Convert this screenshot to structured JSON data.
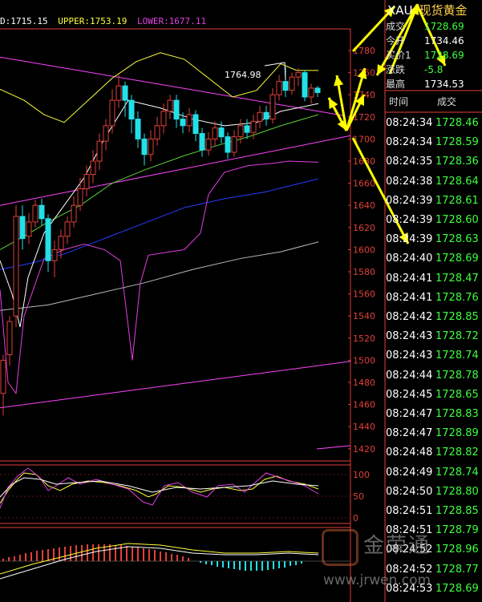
{
  "indicator_bar": {
    "mid_label": "D:1715.15",
    "upper_label": "UPPER:1753.19",
    "lower_label": "LOWER:1677.11",
    "colors": {
      "mid": "#ffffff",
      "upper": "#ffff3a",
      "lower": "#e23fe2"
    }
  },
  "chart_annotation": "1764.98",
  "price_axis": [
    "1780",
    "1760",
    "1740",
    "1720",
    "1700",
    "1680",
    "1660",
    "1640",
    "1620",
    "1600",
    "1580",
    "1560",
    "1540",
    "1520",
    "1500",
    "1480",
    "1460",
    "1440",
    "1420"
  ],
  "osc_axis": [
    "100",
    "50",
    "0"
  ],
  "quote": {
    "code": "XAU",
    "name": "现货黄金",
    "rows": [
      {
        "label": "成交",
        "value": "1728.69"
      },
      {
        "label": "今开",
        "value": "1734.46"
      },
      {
        "label": "买价1",
        "value": "1728.69"
      },
      {
        "label": "涨跌",
        "value": "-5.8"
      },
      {
        "label": "最高",
        "value": "1734.53"
      }
    ]
  },
  "trades": {
    "headers": {
      "time": "时间",
      "price": "成交"
    },
    "rows": [
      {
        "time": "08:24:34",
        "price": "1728.46"
      },
      {
        "time": "08:24:34",
        "price": "1728.59"
      },
      {
        "time": "08:24:35",
        "price": "1728.36"
      },
      {
        "time": "08:24:38",
        "price": "1728.64"
      },
      {
        "time": "08:24:39",
        "price": "1728.61"
      },
      {
        "time": "08:24:39",
        "price": "1728.60"
      },
      {
        "time": "08:24:39",
        "price": "1728.63"
      },
      {
        "time": "08:24:40",
        "price": "1728.69"
      },
      {
        "time": "08:24:41",
        "price": "1728.47"
      },
      {
        "time": "08:24:41",
        "price": "1728.76"
      },
      {
        "time": "08:24:42",
        "price": "1728.85"
      },
      {
        "time": "08:24:43",
        "price": "1728.72"
      },
      {
        "time": "08:24:43",
        "price": "1728.74"
      },
      {
        "time": "08:24:44",
        "price": "1728.78"
      },
      {
        "time": "08:24:45",
        "price": "1728.65"
      },
      {
        "time": "08:24:47",
        "price": "1728.83"
      },
      {
        "time": "08:24:47",
        "price": "1728.89"
      },
      {
        "time": "08:24:48",
        "price": "1728.82"
      },
      {
        "time": "08:24:49",
        "price": "1728.74"
      },
      {
        "time": "08:24:50",
        "price": "1728.80"
      },
      {
        "time": "08:24:51",
        "price": "1728.85"
      },
      {
        "time": "08:24:51",
        "price": "1728.79"
      },
      {
        "time": "08:24:52",
        "price": "1728.96"
      },
      {
        "time": "08:24:52",
        "price": "1728.77"
      },
      {
        "time": "08:24:53",
        "price": "1728.69"
      }
    ]
  },
  "watermark": {
    "name": "金荣通",
    "url": "www.jrwen.com"
  },
  "colors": {
    "axis": "#e0413a",
    "bull": "#e0413a",
    "bear": "#22e0e8",
    "price_up": "#3dff3d",
    "arrow": "#ffff00"
  }
}
